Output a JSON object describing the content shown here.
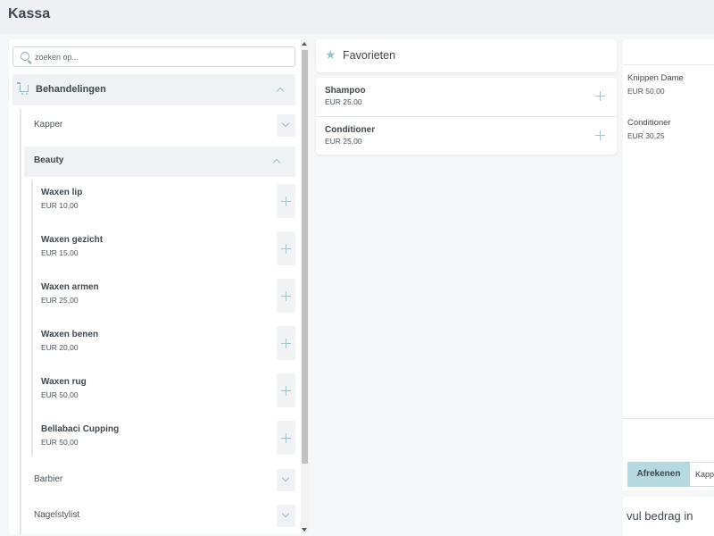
{
  "app": {
    "title": "Kassa"
  },
  "search": {
    "placeholder": "zoeken op..."
  },
  "category": {
    "label": "Behandelingen",
    "subcategories": [
      {
        "label": "Kapper",
        "expanded": false
      },
      {
        "label": "Beauty",
        "expanded": true
      },
      {
        "label": "Barbier",
        "expanded": false
      },
      {
        "label": "Nagelstylist",
        "expanded": false
      }
    ],
    "beauty_services": [
      {
        "name": "Waxen lip",
        "price": "EUR 10,00"
      },
      {
        "name": "Waxen gezicht",
        "price": "EUR 15,00"
      },
      {
        "name": "Waxen armen",
        "price": "EUR 25,00"
      },
      {
        "name": "Waxen benen",
        "price": "EUR 20,00"
      },
      {
        "name": "Waxen rug",
        "price": "EUR 50,00"
      },
      {
        "name": "Bellabaci Cupping",
        "price": "EUR 50,00"
      }
    ]
  },
  "favorites": {
    "title": "Favorieten",
    "items": [
      {
        "name": "Shampoo",
        "price": "EUR 25,00"
      },
      {
        "name": "Conditioner",
        "price": "EUR 25,00"
      }
    ]
  },
  "cart": {
    "lines": [
      {
        "name": "Knippen Dame",
        "price": "EUR 50,00"
      },
      {
        "name": "Conditioner",
        "price": "EUR 30,25"
      }
    ],
    "checkout_label": "Afrekenen",
    "tab_label": "Kappers",
    "amount_placeholder": "vul bedrag in"
  },
  "colors": {
    "accent": "#b6d8e0",
    "icon": "#9bb9c4",
    "panel": "#ffffff",
    "background": "#f4f6f8"
  },
  "icons": {
    "search": "search-icon",
    "cart": "cart-icon",
    "star": "star-icon",
    "add": "plus-icon",
    "expand": "chevron-down-icon",
    "collapse": "chevron-up-icon"
  }
}
